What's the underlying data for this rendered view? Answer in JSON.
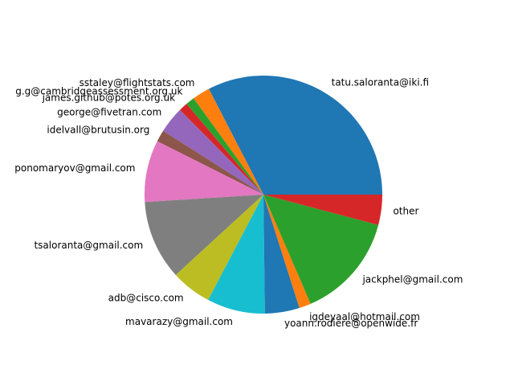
{
  "chart_data": {
    "type": "pie",
    "start_angle_deg": 0,
    "direction": "counterclockwise",
    "slices": [
      {
        "label": "tatu.saloranta@iki.fi",
        "value": 32.6,
        "color": "#1f77b4"
      },
      {
        "label": "sstaley@flightstats.com",
        "value": 2.4,
        "color": "#ff7f0e"
      },
      {
        "label": "g.g@cambridgeassessment.org.uk",
        "value": 1.2,
        "color": "#2ca02c"
      },
      {
        "label": "james.github@potes.org.uk",
        "value": 1.2,
        "color": "#d62728"
      },
      {
        "label": "george@fivetran.com",
        "value": 3.6,
        "color": "#9467bd"
      },
      {
        "label": "idelvall@brutusin.org",
        "value": 1.6,
        "color": "#8c564b"
      },
      {
        "label": "ponomaryov@gmail.com",
        "value": 8.4,
        "color": "#e377c2"
      },
      {
        "label": "tsaloranta@gmail.com",
        "value": 10.8,
        "color": "#7f7f7f"
      },
      {
        "label": "adb@cisco.com",
        "value": 5.5,
        "color": "#bcbd22"
      },
      {
        "label": "mavarazy@gmail.com",
        "value": 7.9,
        "color": "#17becf"
      },
      {
        "label": "yoann.rodiere@openwide.fr",
        "value": 4.7,
        "color": "#1f77b4"
      },
      {
        "label": "igdeyaal@hotmail.com",
        "value": 1.6,
        "color": "#ff7f0e"
      },
      {
        "label": "jackphel@gmail.com",
        "value": 14.4,
        "color": "#2ca02c"
      },
      {
        "label": "other",
        "value": 4.1,
        "color": "#d62728"
      }
    ]
  }
}
